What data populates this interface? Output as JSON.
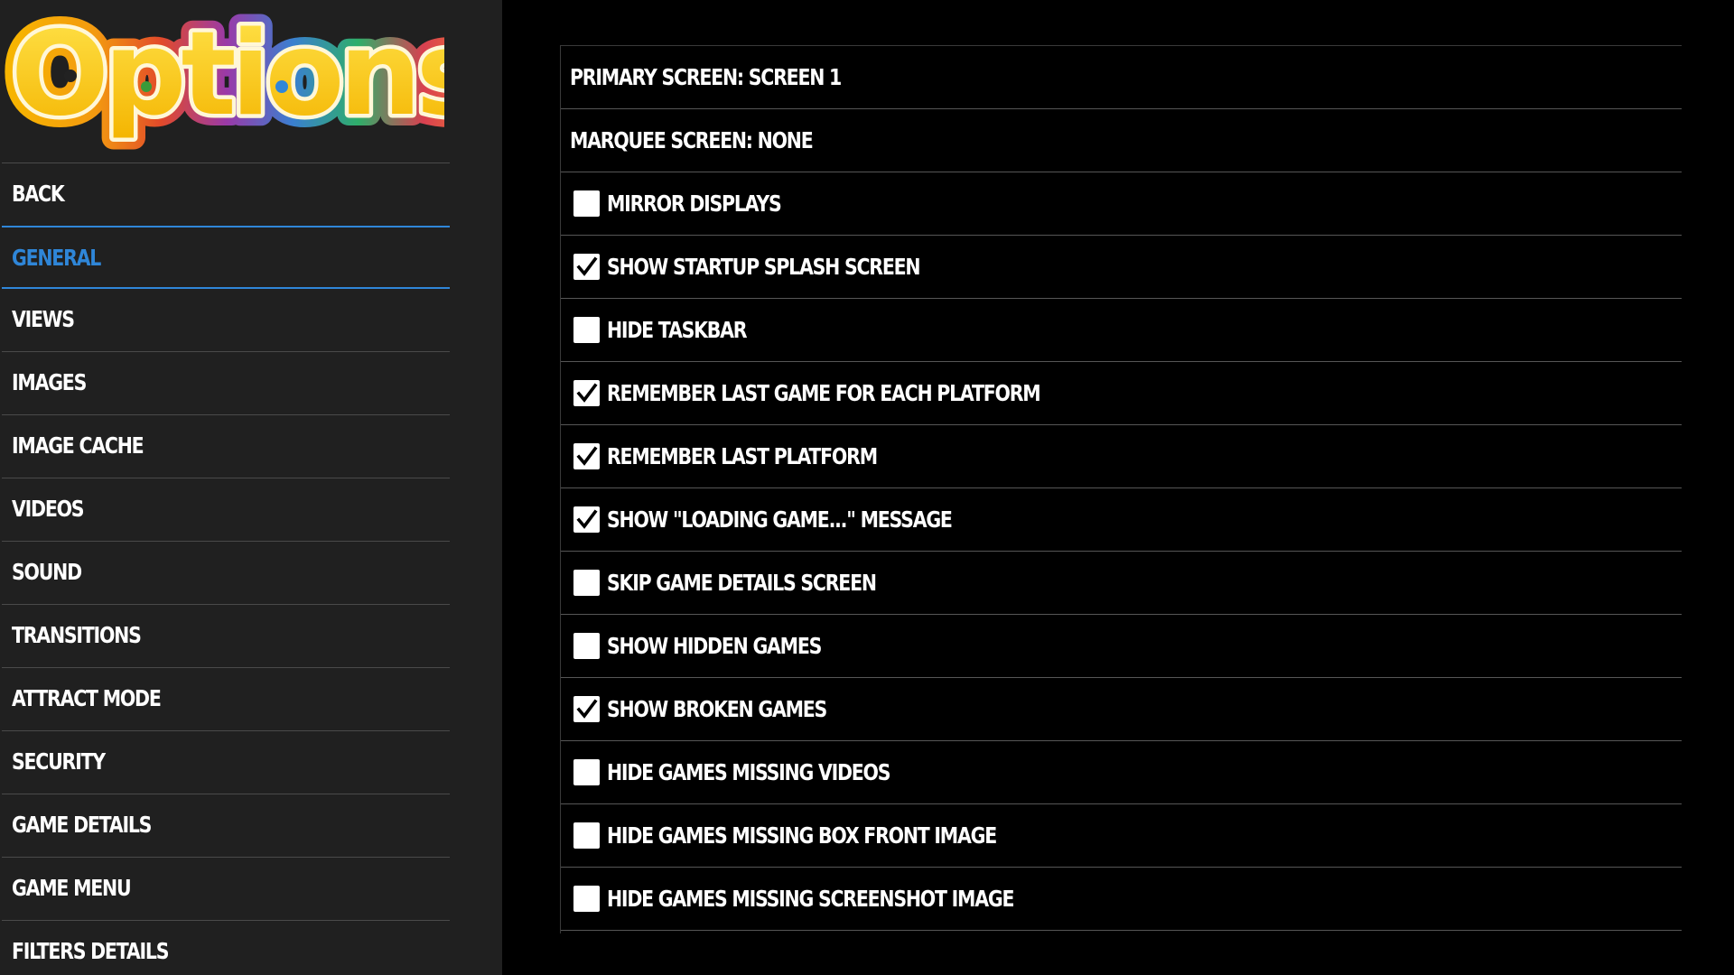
{
  "sidebar": {
    "logo_text": "Options",
    "items": [
      {
        "label": "BACK",
        "selected": false
      },
      {
        "label": "GENERAL",
        "selected": true
      },
      {
        "label": "VIEWS",
        "selected": false
      },
      {
        "label": "IMAGES",
        "selected": false
      },
      {
        "label": "IMAGE CACHE",
        "selected": false
      },
      {
        "label": "VIDEOS",
        "selected": false
      },
      {
        "label": "SOUND",
        "selected": false
      },
      {
        "label": "TRANSITIONS",
        "selected": false
      },
      {
        "label": "ATTRACT MODE",
        "selected": false
      },
      {
        "label": "SECURITY",
        "selected": false
      },
      {
        "label": "GAME DETAILS",
        "selected": false
      },
      {
        "label": "GAME MENU",
        "selected": false
      },
      {
        "label": "FILTERS DETAILS",
        "selected": false
      }
    ]
  },
  "main": {
    "options": [
      {
        "label": "PRIMARY SCREEN: SCREEN 1",
        "type": "select"
      },
      {
        "label": "MARQUEE SCREEN: NONE",
        "type": "select"
      },
      {
        "label": "MIRROR DISPLAYS",
        "type": "checkbox",
        "checked": false
      },
      {
        "label": "SHOW STARTUP SPLASH SCREEN",
        "type": "checkbox",
        "checked": true
      },
      {
        "label": "HIDE TASKBAR",
        "type": "checkbox",
        "checked": false
      },
      {
        "label": "REMEMBER LAST GAME FOR EACH PLATFORM",
        "type": "checkbox",
        "checked": true
      },
      {
        "label": "REMEMBER LAST PLATFORM",
        "type": "checkbox",
        "checked": true
      },
      {
        "label": "SHOW \"LOADING GAME...\" MESSAGE",
        "type": "checkbox",
        "checked": true
      },
      {
        "label": "SKIP GAME DETAILS SCREEN",
        "type": "checkbox",
        "checked": false
      },
      {
        "label": "SHOW HIDDEN GAMES",
        "type": "checkbox",
        "checked": false
      },
      {
        "label": "SHOW BROKEN GAMES",
        "type": "checkbox",
        "checked": true
      },
      {
        "label": "HIDE GAMES MISSING VIDEOS",
        "type": "checkbox",
        "checked": false
      },
      {
        "label": "HIDE GAMES MISSING BOX FRONT IMAGE",
        "type": "checkbox",
        "checked": false
      },
      {
        "label": "HIDE GAMES MISSING SCREENSHOT IMAGE",
        "type": "checkbox",
        "checked": false
      }
    ]
  },
  "colors": {
    "background": "#000000",
    "sidebar_bg": "#202020",
    "accent": "#2f86d8",
    "text": "#ffffff",
    "divider": "#565656"
  }
}
